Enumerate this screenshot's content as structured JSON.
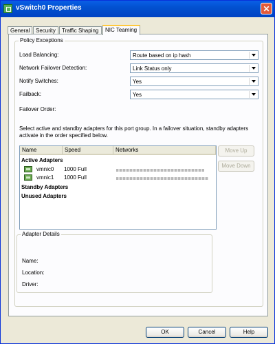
{
  "window": {
    "title": "vSwitch0 Properties"
  },
  "tabs": [
    {
      "label": "General"
    },
    {
      "label": "Security"
    },
    {
      "label": "Traffic Shaping"
    },
    {
      "label": "NIC Teaming"
    }
  ],
  "policy": {
    "group_label": "Policy Exceptions",
    "rows": [
      {
        "label": "Load Balancing:",
        "value": "Route based on ip hash"
      },
      {
        "label": "Network Failover Detection:",
        "value": "Link Status only"
      },
      {
        "label": "Notify Switches:",
        "value": "Yes"
      },
      {
        "label": "Failback:",
        "value": "Yes"
      }
    ],
    "failover_order_label": "Failover Order:",
    "description": "Select active and standby adapters for this port group.  In a failover situation, standby adapters activate  in the order specified below."
  },
  "adapters": {
    "columns": [
      "Name",
      "Speed",
      "Networks"
    ],
    "active_header": "Active Adapters",
    "active": [
      {
        "name": "vmnic0",
        "speed": "1000 Full",
        "icon": "nic-icon"
      },
      {
        "name": "vmnic1",
        "speed": "1000 Full",
        "icon": "nic-icon"
      }
    ],
    "standby_header": "Standby Adapters",
    "unused_header": "Unused Adapters",
    "move_up": "Move Up",
    "move_down": "Move Down"
  },
  "details": {
    "group_label": "Adapter Details",
    "name_label": "Name:",
    "location_label": "Location:",
    "driver_label": "Driver:"
  },
  "buttons": {
    "ok": "OK",
    "cancel": "Cancel",
    "help": "Help"
  }
}
